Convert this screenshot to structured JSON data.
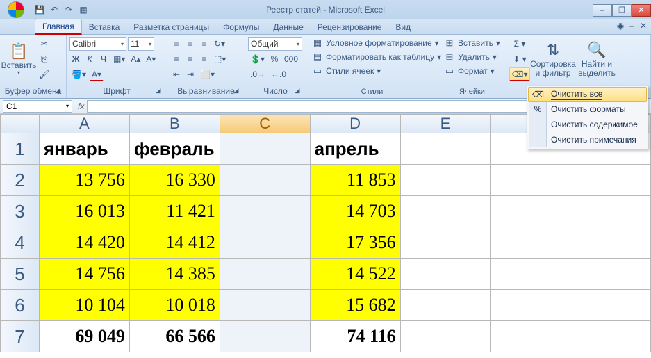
{
  "title": "Реестр статей - Microsoft Excel",
  "qat": {
    "save": "💾",
    "undo": "↶",
    "redo": "↷",
    "extra": "▦"
  },
  "tabs": {
    "t1": "Главная",
    "t2": "Вставка",
    "t3": "Разметка страницы",
    "t4": "Формулы",
    "t5": "Данные",
    "t6": "Рецензирование",
    "t7": "Вид"
  },
  "groups": {
    "clipboard": {
      "paste": "Вставить",
      "label": "Буфер обмена"
    },
    "font": {
      "name": "Calibri",
      "size": "11",
      "label": "Шрифт",
      "bold": "Ж",
      "italic": "К",
      "underline": "Ч"
    },
    "align": {
      "label": "Выравнивание"
    },
    "number": {
      "format": "Общий",
      "label": "Число"
    },
    "styles": {
      "cond": "Условное форматирование",
      "table": "Форматировать как таблицу",
      "cell": "Стили ячеек",
      "label": "Стили"
    },
    "cells": {
      "insert": "Вставить",
      "delete": "Удалить",
      "format": "Формат",
      "label": "Ячейки"
    },
    "editing": {
      "sort": "Сортировка и фильтр",
      "find": "Найти и выделить"
    }
  },
  "namebox": "C1",
  "columns": [
    "A",
    "B",
    "C",
    "D",
    "E"
  ],
  "rows": [
    "1",
    "2",
    "3",
    "4",
    "5",
    "6",
    "7"
  ],
  "headers": {
    "A": "январь",
    "B": "февраль",
    "C": "",
    "D": "апрель"
  },
  "data": [
    {
      "A": "13 756",
      "B": "16 330",
      "D": "11 853"
    },
    {
      "A": "16 013",
      "B": "11 421",
      "D": "14 703"
    },
    {
      "A": "14 420",
      "B": "14 412",
      "D": "17 356"
    },
    {
      "A": "14 756",
      "B": "14 385",
      "D": "14 522"
    },
    {
      "A": "10 104",
      "B": "10 018",
      "D": "15 682"
    }
  ],
  "sums": {
    "A": "69 049",
    "B": "66 566",
    "D": "74 116"
  },
  "menu": {
    "m1": "Очистить все",
    "m2": "Очистить форматы",
    "m3": "Очистить содержимое",
    "m4": "Очистить примечания"
  },
  "colw": {
    "A": 130,
    "B": 130,
    "C": 130,
    "D": 130,
    "E": 130
  }
}
